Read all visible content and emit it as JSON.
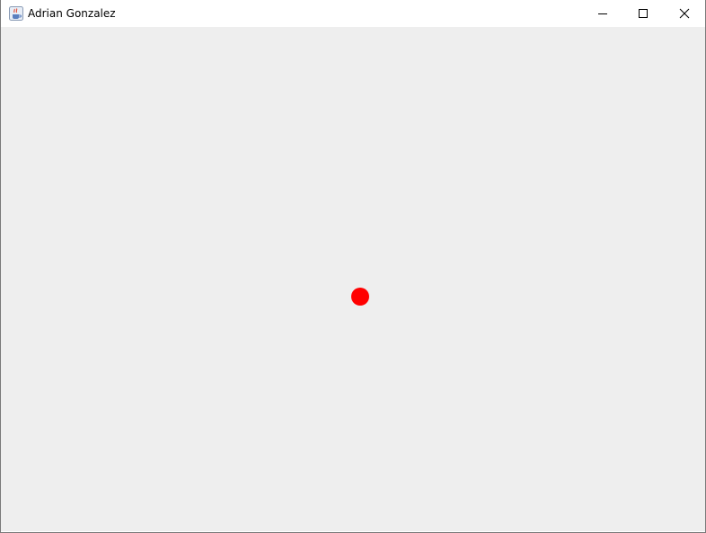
{
  "window": {
    "title": "Adrian Gonzalez",
    "app_icon": "java-cup-icon",
    "controls": {
      "minimize_icon": "minimize-icon",
      "maximize_icon": "maximize-icon",
      "close_icon": "close-icon"
    }
  },
  "canvas": {
    "background_color": "#eeeeee",
    "ball_color": "#ff0000"
  }
}
